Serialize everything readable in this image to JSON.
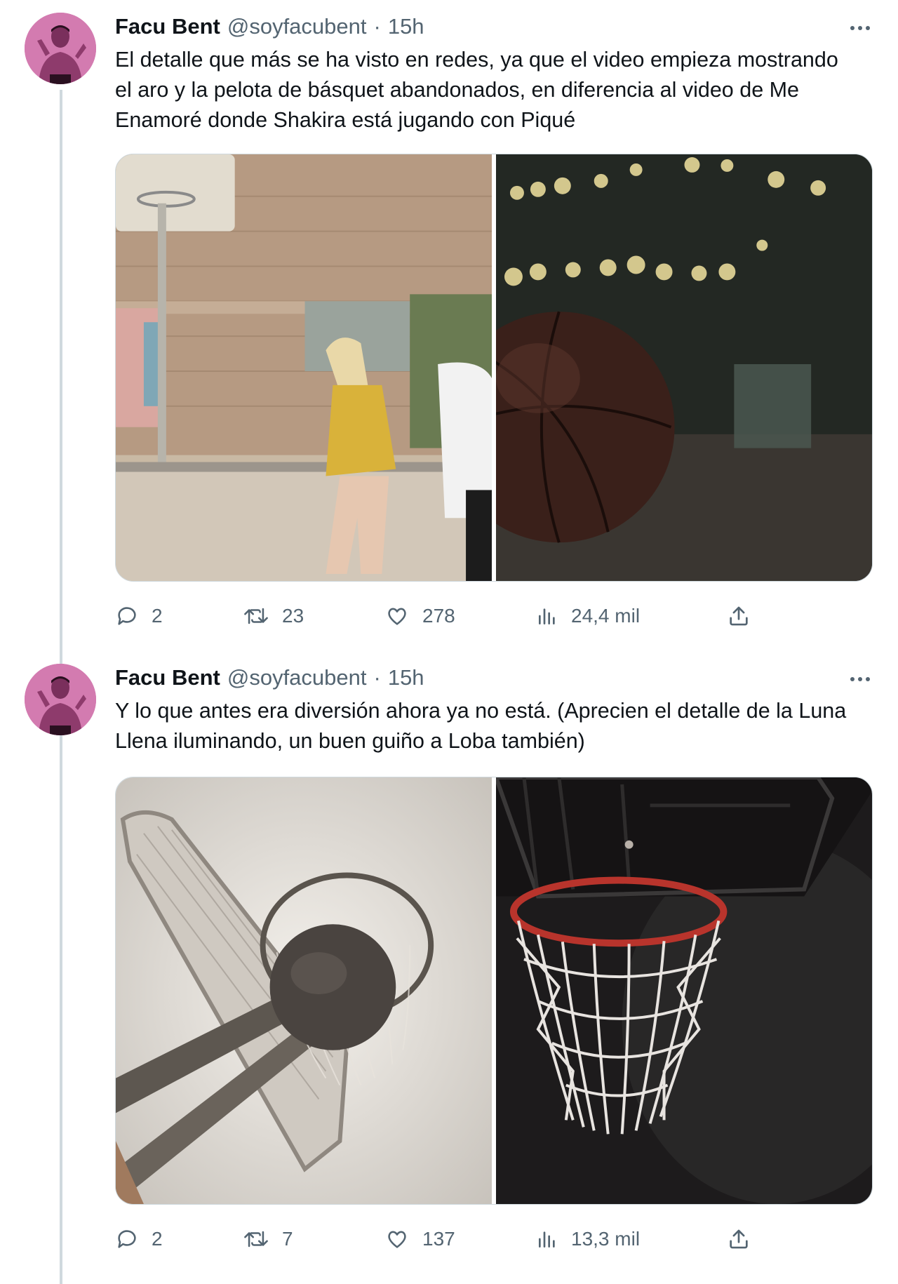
{
  "tweets": [
    {
      "author": {
        "display_name": "Facu Bent",
        "handle": "@soyfacubent"
      },
      "separator": "·",
      "time": "15h",
      "text": "El detalle que más se ha visto en redes, ya que el video empieza mostrando el aro y la pelota de básquet abandonados, en diferencia al video de Me Enamoré donde Shakira está jugando con Piqué",
      "media": [
        {
          "description": "woman-playing-basketball-street-court"
        },
        {
          "description": "basketball-on-dark-court-bokeh-lights"
        }
      ],
      "stats": {
        "replies": "2",
        "retweets": "23",
        "likes": "278",
        "views": "24,4 mil"
      }
    },
    {
      "author": {
        "display_name": "Facu Bent",
        "handle": "@soyfacubent"
      },
      "separator": "·",
      "time": "15h",
      "text": "Y lo que antes era diversión ahora ya no está. (Aprecien el detalle de la Luna Llena iluminando, un buen guiño a Loba también)",
      "media": [
        {
          "description": "ball-entering-hoop-against-sky"
        },
        {
          "description": "red-rim-white-net-dark-background"
        }
      ],
      "stats": {
        "replies": "2",
        "retweets": "7",
        "likes": "137",
        "views": "13,3 mil"
      }
    }
  ],
  "icons": {
    "more": "more-dots-icon",
    "reply": "reply-icon",
    "retweet": "retweet-icon",
    "like": "heart-icon",
    "views": "views-chart-icon",
    "share": "share-icon"
  },
  "colors": {
    "text": "#0f1419",
    "secondary": "#536471",
    "thread_line": "#cfd9de",
    "avatar_bg": "#cf6aa8"
  }
}
